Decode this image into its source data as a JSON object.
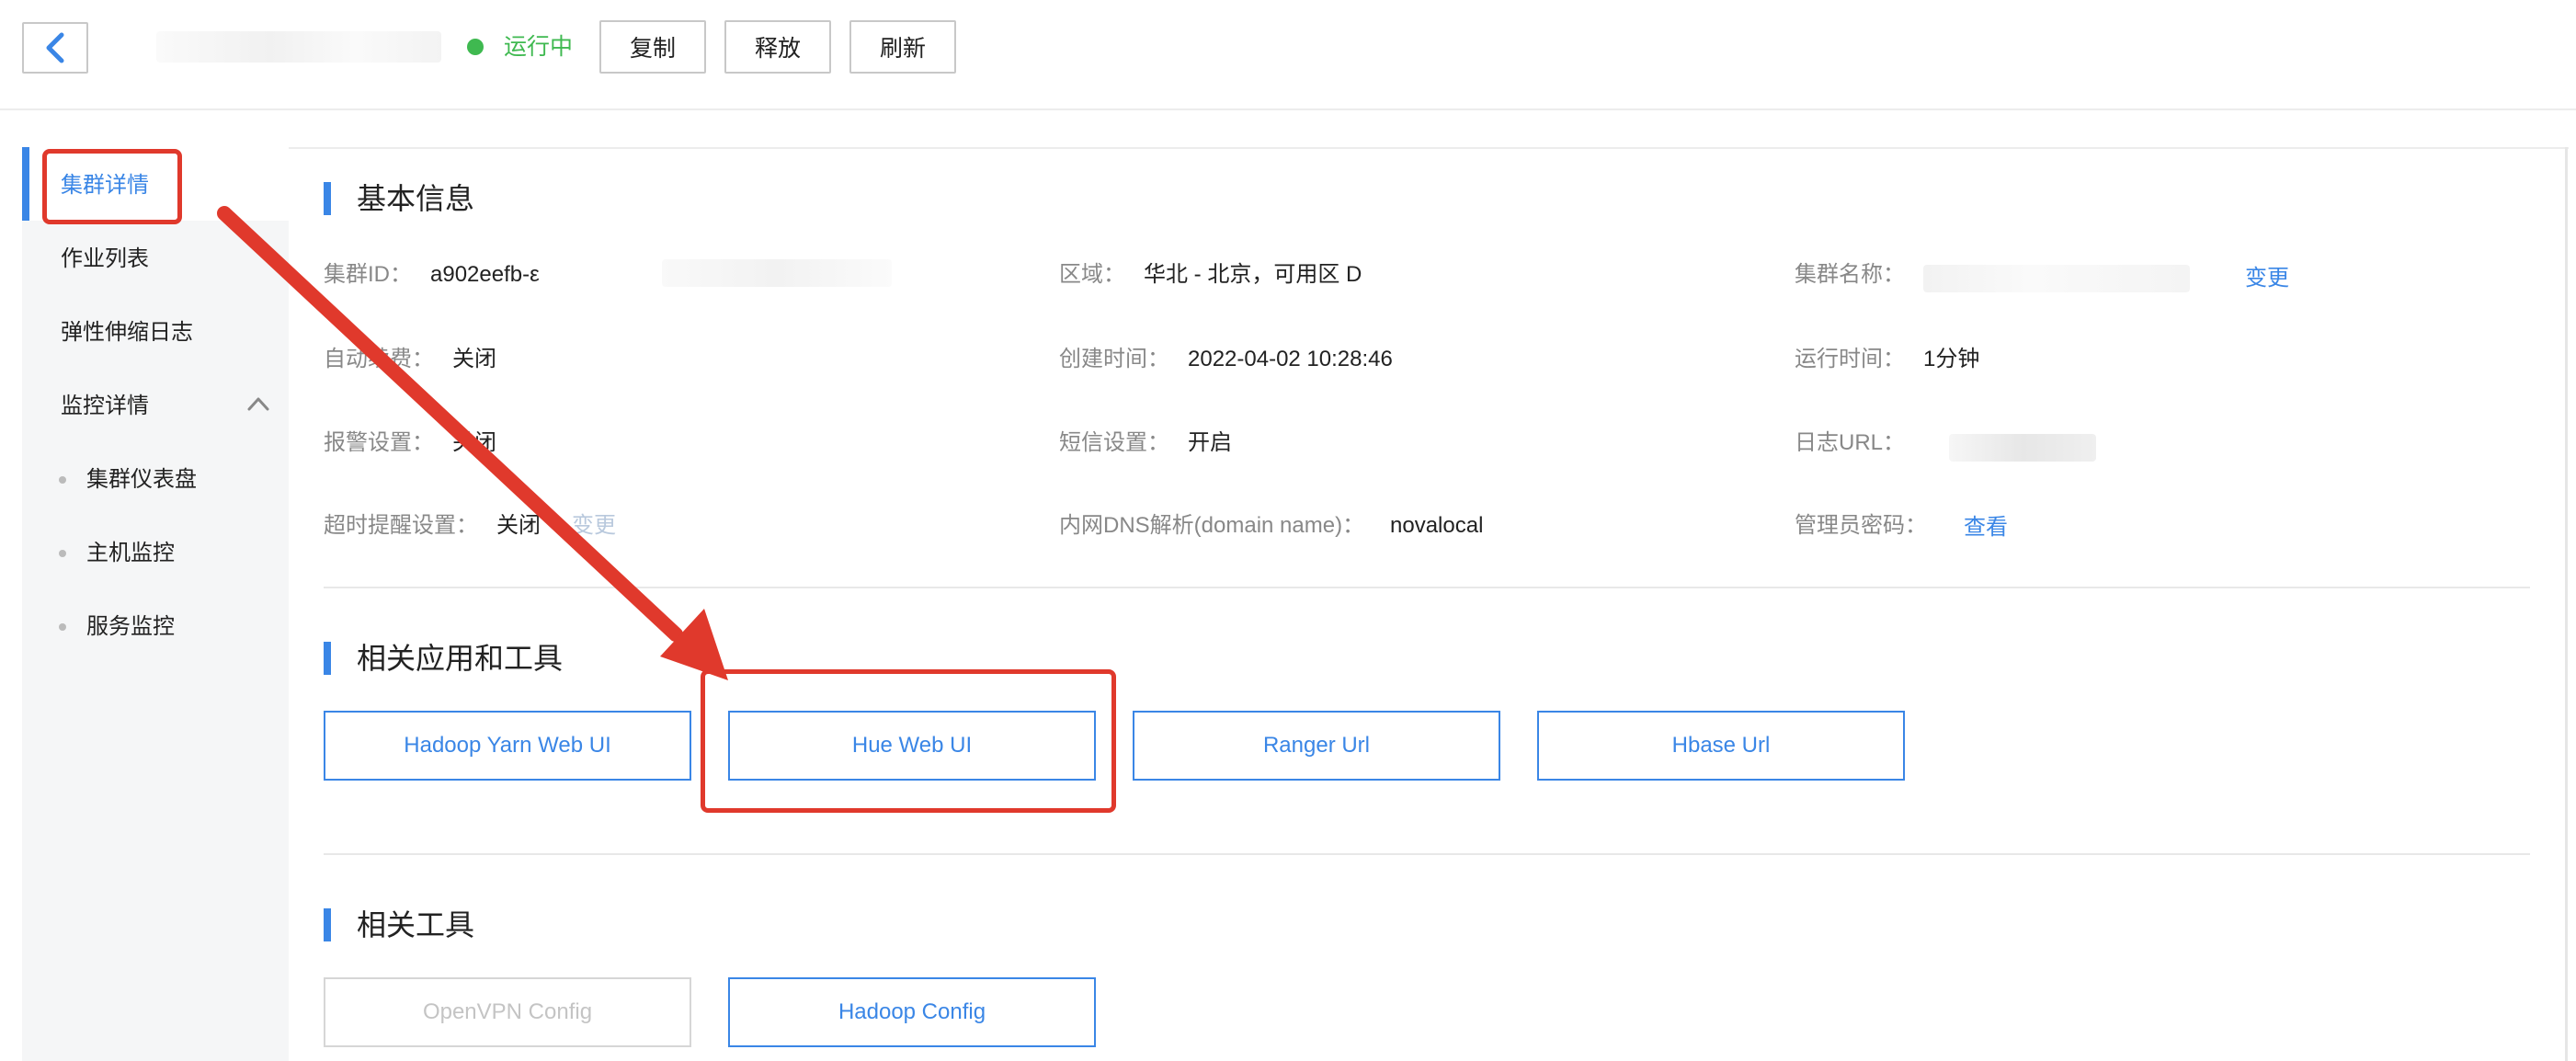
{
  "header": {
    "status_text": "运行中",
    "status_color": "#3fb950",
    "buttons": {
      "copy": "复制",
      "release": "释放",
      "refresh": "刷新"
    }
  },
  "sidebar": {
    "items": [
      {
        "label": "集群详情",
        "active": true
      },
      {
        "label": "作业列表"
      },
      {
        "label": "弹性伸缩日志"
      },
      {
        "label": "监控详情",
        "expanded": true
      }
    ],
    "sub_items": [
      {
        "label": "集群仪表盘"
      },
      {
        "label": "主机监控"
      },
      {
        "label": "服务监控"
      }
    ]
  },
  "basic_info": {
    "title": "基本信息",
    "cluster_id_label": "集群ID：",
    "cluster_id_value": "a902eefb-ε",
    "region_label": "区域：",
    "region_value": "华北 - 北京，可用区 D",
    "cluster_name_label": "集群名称：",
    "change_link": "变更",
    "auto_renew_label": "自动续费：",
    "auto_renew_value": "关闭",
    "create_time_label": "创建时间：",
    "create_time_value": "2022-04-02 10:28:46",
    "run_time_label": "运行时间：",
    "run_time_value": "1分钟",
    "alarm_label": "报警设置：",
    "alarm_value": "关闭",
    "sms_label": "短信设置：",
    "sms_value": "开启",
    "log_url_label": "日志URL：",
    "timeout_label": "超时提醒设置：",
    "timeout_value": "关闭",
    "timeout_change": "变更",
    "dns_label": "内网DNS解析(domain name)：",
    "dns_value": "novalocal",
    "admin_pwd_label": "管理员密码：",
    "admin_pwd_link": "查看"
  },
  "apps": {
    "title": "相关应用和工具",
    "buttons": [
      "Hadoop Yarn Web UI",
      "Hue Web UI",
      "Ranger Url",
      "Hbase Url"
    ]
  },
  "tools": {
    "title": "相关工具",
    "buttons": [
      {
        "label": "OpenVPN Config",
        "disabled": true
      },
      {
        "label": "Hadoop Config",
        "disabled": false
      }
    ]
  },
  "colors": {
    "accent": "#3a86e6",
    "annotation": "#e0392c"
  },
  "icons": {
    "back": "chevron-left-icon",
    "collapse": "chevron-up-icon"
  }
}
